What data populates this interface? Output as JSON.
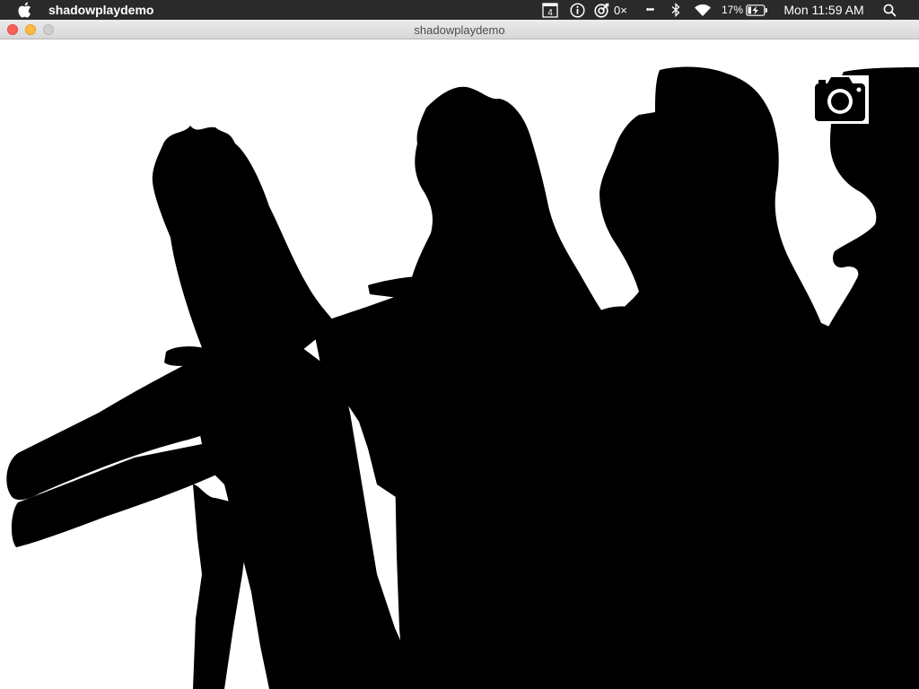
{
  "menubar": {
    "app_name": "shadowplaydemo",
    "calendar_day": "4",
    "counter_text": "0×",
    "more_dots": "•••",
    "battery_percent": "17%",
    "clock": "Mon 11:59 AM"
  },
  "window": {
    "title": "shadowplaydemo"
  },
  "icons": {
    "apple": "apple-logo-icon",
    "calendar": "calendar-icon",
    "info": "info-icon",
    "target": "target-icon",
    "bluetooth": "bluetooth-icon",
    "wifi": "wifi-icon",
    "battery": "battery-charging-icon",
    "search": "spotlight-search-icon",
    "camera": "camera-icon"
  },
  "colors": {
    "menubar_bg": "#2a2a2a",
    "silhouette": "#000000",
    "background": "#ffffff",
    "close": "#fc605b",
    "minimize": "#fdbc40",
    "maximize": "#cfcfcf"
  }
}
